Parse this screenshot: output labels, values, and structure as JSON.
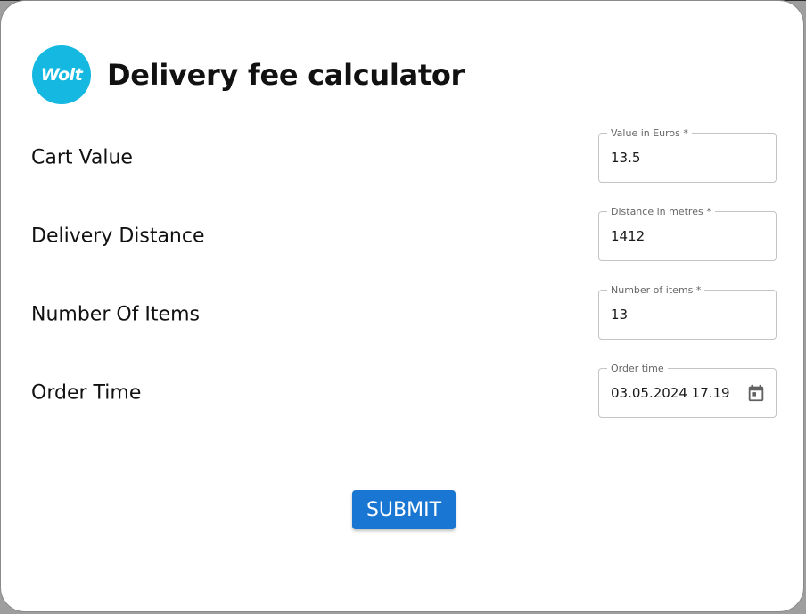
{
  "header": {
    "logo_text": "Wolt",
    "title": "Delivery fee calculator"
  },
  "form": {
    "rows": [
      {
        "label": "Cart Value",
        "field_legend": "Value in Euros *",
        "value": "13.5"
      },
      {
        "label": "Delivery Distance",
        "field_legend": "Distance in metres *",
        "value": "1412"
      },
      {
        "label": "Number Of Items",
        "field_legend": "Number of items *",
        "value": "13"
      },
      {
        "label": "Order Time",
        "field_legend": "Order time",
        "value": "03.05.2024 17.19",
        "icon": "calendar-icon"
      }
    ],
    "submit_label": "SUBMIT"
  },
  "colors": {
    "brand": "#14b8e0",
    "primary": "#1976d2",
    "field_border": "#c4c4c4"
  }
}
